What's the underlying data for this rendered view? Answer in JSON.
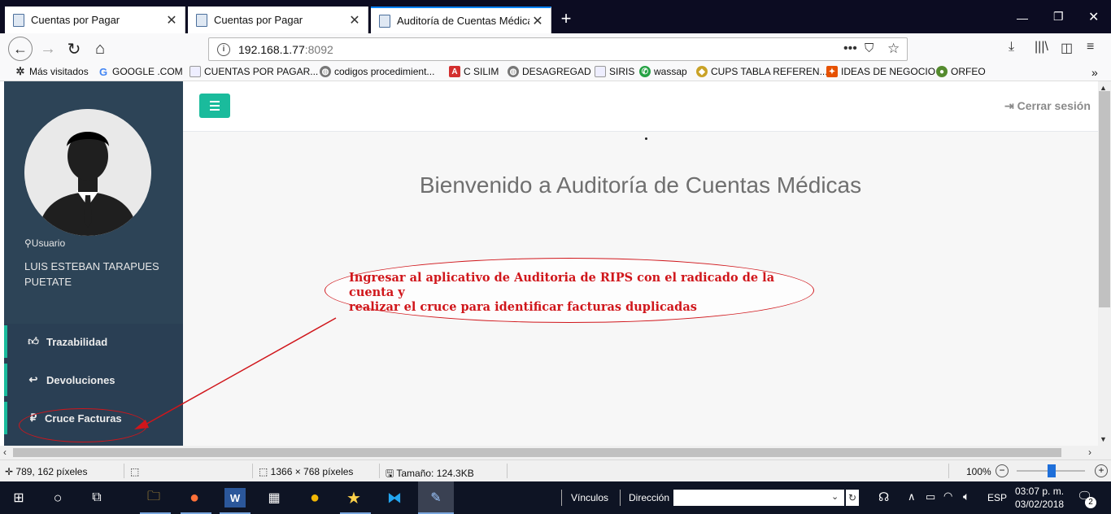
{
  "browser": {
    "tabs": [
      {
        "title": "Cuentas por Pagar",
        "active": false
      },
      {
        "title": "Cuentas por Pagar",
        "active": false
      },
      {
        "title": "Auditoría de Cuentas Médicas |",
        "active": true
      }
    ],
    "url_host": "192.168.1.77",
    "url_port": ":8092",
    "bookmarks": [
      "Más visitados",
      "GOOGLE .COM",
      "CUENTAS POR PAGAR...",
      "codigos procedimient...",
      "C SILIM",
      "DESAGREGAD",
      "SIRIS",
      "wassap",
      "CUPS TABLA REFEREN...",
      "IDEAS DE NEGOCIO",
      "ORFEO"
    ]
  },
  "app": {
    "logout_label": "Cerrar sesión",
    "user_label": "Usuario",
    "user_name": "LUIS ESTEBAN TARAPUES PUETATE",
    "menu": [
      "Trazabilidad",
      "Devoluciones",
      "Cruce Facturas"
    ],
    "welcome": "Bienvenido a Auditoría de Cuentas Médicas"
  },
  "annotation": {
    "line1": "Ingresar al aplicativo de Auditoria de RIPS con el radicado de la cuenta y",
    "line2": "realizar el cruce para identificar facturas duplicadas"
  },
  "statusbar": {
    "coords": "789, 162 píxeles",
    "dimensions": "1366 × 768 píxeles",
    "size": "Tamaño: 124.3KB",
    "zoom": "100%",
    "zoom_level": 0.5
  },
  "taskbar": {
    "links_label": "Vínculos",
    "address_label": "Dirección",
    "language": "ESP",
    "time": "03:07 p. m.",
    "date": "03/02/2018",
    "notifications": "2"
  },
  "colors": {
    "accent": "#1abb9c",
    "sidebar": "#2a3f54",
    "annotation": "#d0161b"
  }
}
